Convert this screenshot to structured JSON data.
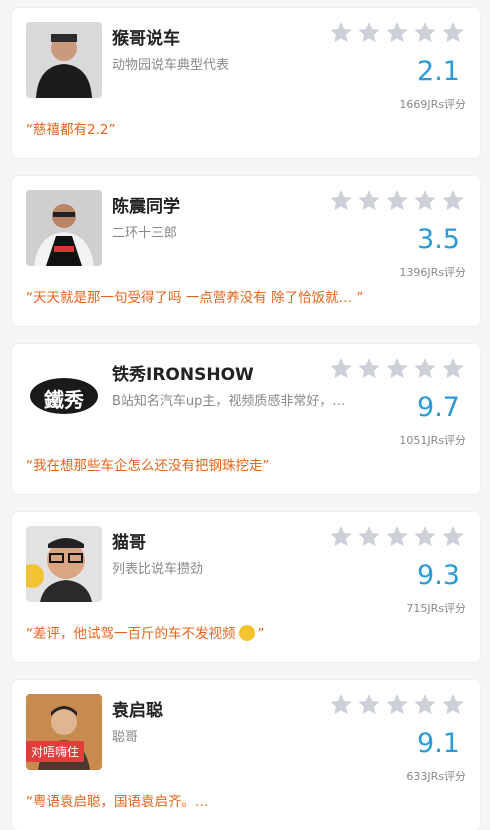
{
  "reviewers": [
    {
      "name": "猴哥说车",
      "desc": "动物园说车典型代表",
      "score": "2.1",
      "count": "1669JRs评分",
      "quote": "“慈禧都有2.2”"
    },
    {
      "name": "陈震同学",
      "desc": "二环十三郎",
      "score": "3.5",
      "count": "1396JRs评分",
      "quote": "“天天就是那一句受得了吗 一点营养没有  除了恰饭就…  ”"
    },
    {
      "name": "铁秀IRONSHOW",
      "desc": "B站知名汽车up主，视频质感非常好，…",
      "score": "9.7",
      "count": "1051JRs评分",
      "quote": "“我在想那些车企怎么还没有把钢珠挖走”",
      "logo_text": "鐵秀"
    },
    {
      "name": "猫哥",
      "desc": "列表比说车攒劲",
      "score": "9.3",
      "count": "715JRs评分",
      "quote": "“差评，他试驾一百斤的车不发视频",
      "quote_end": "”"
    },
    {
      "name": "袁启聪",
      "desc": "聪哥",
      "score": "9.1",
      "count": "633JRs评分",
      "quote": "“粤语袁启聪，国语袁启齐。…",
      "avatar_tag": "对唔嗨住"
    }
  ],
  "star_color": "#cdd0d6",
  "score_color": "#2a9ad8",
  "quote_color": "#e8631a"
}
